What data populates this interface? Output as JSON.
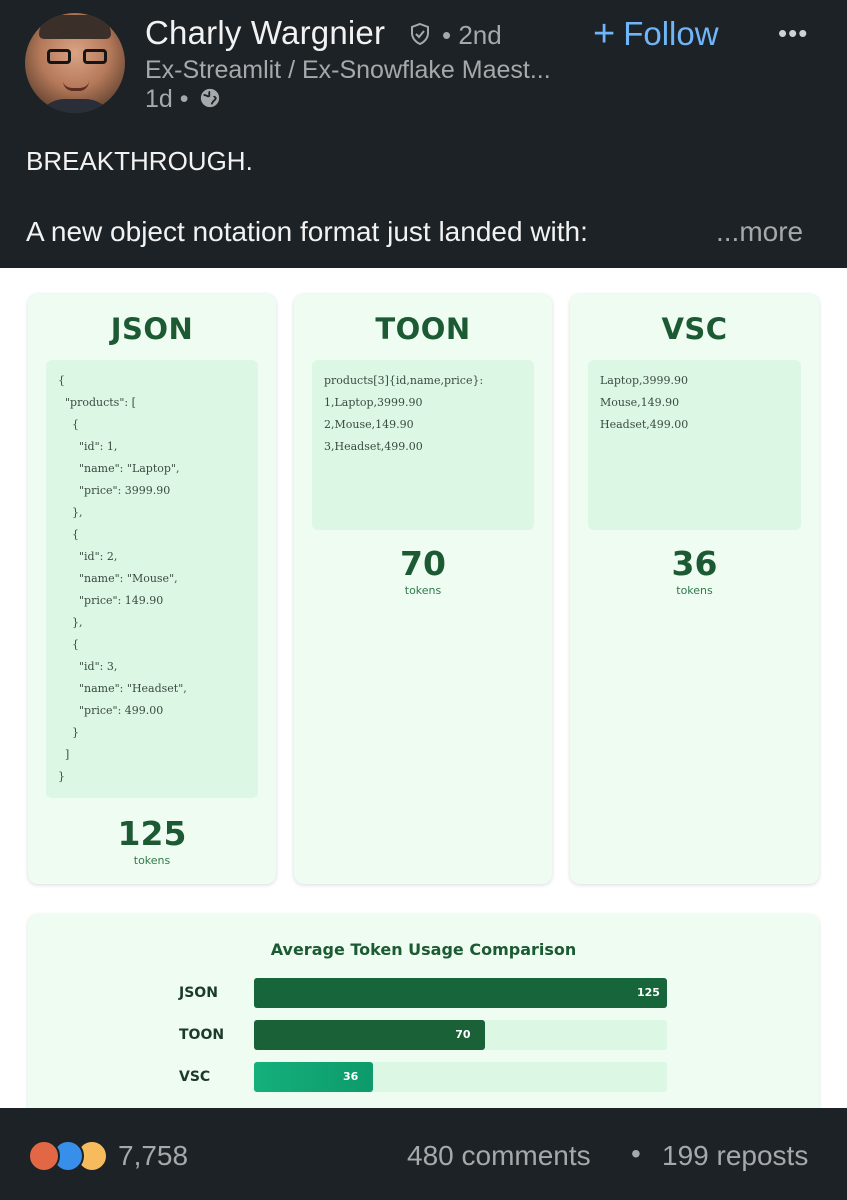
{
  "post": {
    "author": {
      "name": "Charly Wargnier",
      "degree": "• 2nd",
      "headline": "Ex-Streamlit / Ex-Snowflake Maest...",
      "time": "1d •"
    },
    "follow_label": "Follow",
    "follow_plus": "+",
    "more_label": "•••",
    "text_line1": "BREAKTHROUGH.",
    "text_line2": "A new object notation format just landed with:",
    "see_more": "...more"
  },
  "image": {
    "cards": [
      {
        "title": "JSON",
        "code": [
          "{",
          "  \"products\": [",
          "    {",
          "      \"id\": 1,",
          "      \"name\": \"Laptop\",",
          "      \"price\": 3999.90",
          "    },",
          "    {",
          "      \"id\": 2,",
          "      \"name\": \"Mouse\",",
          "      \"price\": 149.90",
          "    },",
          "    {",
          "      \"id\": 3,",
          "      \"name\": \"Headset\",",
          "      \"price\": 499.00",
          "    }",
          "  ]",
          "}"
        ],
        "count": "125",
        "count_label": "tokens"
      },
      {
        "title": "TOON",
        "code": [
          "products[3]{id,name,price}:",
          "1,Laptop,3999.90",
          "2,Mouse,149.90",
          "3,Headset,499.00"
        ],
        "count": "70",
        "count_label": "tokens"
      },
      {
        "title": "VSC",
        "code": [
          "Laptop,3999.90",
          "Mouse,149.90",
          "Headset,499.00"
        ],
        "count": "36",
        "count_label": "tokens"
      }
    ],
    "chart_data": {
      "type": "bar",
      "orientation": "horizontal",
      "title": "Average Token Usage Comparison",
      "categories": [
        "JSON",
        "TOON",
        "VSC"
      ],
      "values": [
        125,
        70,
        36
      ],
      "xlim": [
        0,
        125
      ],
      "colors": [
        "#17653a",
        "#1b6138",
        "#12a676"
      ]
    }
  },
  "social": {
    "reaction_count": "7,758",
    "comments": "480 comments",
    "separator": "•",
    "reposts": "199 reposts"
  },
  "colors": {
    "background": "#1d2226",
    "accent": "#70b5f9",
    "green_dark": "#1c5a33",
    "card_bg": "#effcf2",
    "code_bg": "#dcf8e4"
  }
}
